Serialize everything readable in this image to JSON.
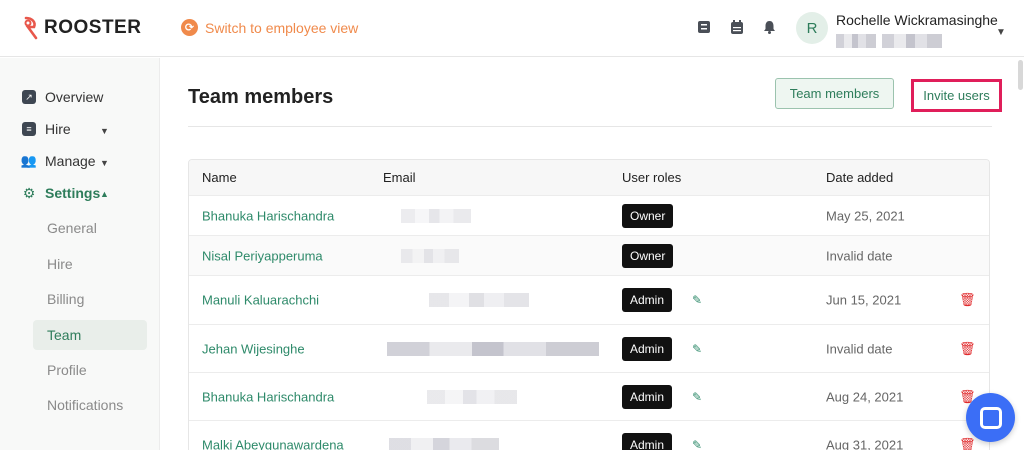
{
  "brand": {
    "name": "ROOSTER"
  },
  "topbar": {
    "switch_label": "Switch to employee view",
    "icons": [
      "checklist-icon",
      "calendar-icon",
      "bell-icon"
    ],
    "user": {
      "initial": "R",
      "name": "Rochelle Wickramasinghe"
    }
  },
  "sidebar": {
    "items": [
      {
        "label": "Overview",
        "icon": "overview-icon"
      },
      {
        "label": "Hire",
        "icon": "hire-icon"
      },
      {
        "label": "Manage",
        "icon": "manage-icon"
      },
      {
        "label": "Settings",
        "icon": "settings-icon"
      }
    ],
    "settings_subitems": [
      "General",
      "Hire",
      "Billing",
      "Team",
      "Profile",
      "Notifications"
    ],
    "selected_subitem": "Team"
  },
  "main": {
    "title": "Team members",
    "team_members_button": "Team members",
    "invite_button": "Invite users",
    "table": {
      "headers": [
        "Name",
        "Email",
        "User roles",
        "Date added"
      ],
      "rows": [
        {
          "name": "Bhanuka Harischandra",
          "role": "Owner",
          "date": "May 25, 2021",
          "editable": false
        },
        {
          "name": "Nisal Periyapperuma",
          "role": "Owner",
          "date": "Invalid date",
          "editable": false
        },
        {
          "name": "Manuli Kaluarachchi",
          "role": "Admin",
          "date": "Jun 15, 2021",
          "editable": true
        },
        {
          "name": "Jehan Wijesinghe",
          "role": "Admin",
          "date": "Invalid date",
          "editable": true
        },
        {
          "name": "Bhanuka Harischandra",
          "role": "Admin",
          "date": "Aug 24, 2021",
          "editable": true
        },
        {
          "name": "Malki Abeygunawardena",
          "role": "Admin",
          "date": "Aug 31, 2021",
          "editable": true
        }
      ]
    }
  },
  "colors": {
    "accent": "#2e7d5b",
    "highlight": "#e01e5a",
    "orange": "#f08a4b",
    "delete": "#e0292b",
    "chat": "#3b6ef6"
  }
}
